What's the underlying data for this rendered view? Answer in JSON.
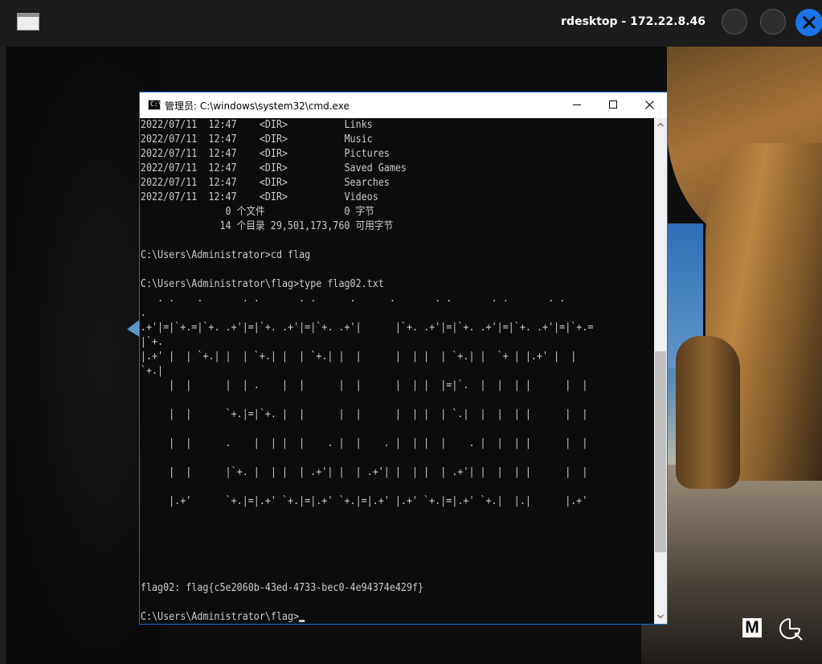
{
  "outer_window": {
    "title": "rdesktop - 172.22.8.46",
    "controls": [
      "minimize",
      "maximize",
      "close"
    ]
  },
  "cmd_window": {
    "title": "管理员: C:\\windows\\system32\\cmd.exe",
    "icon_label": "C:\\",
    "console_lines": [
      "2022/07/11  12:47    <DIR>          Links",
      "2022/07/11  12:47    <DIR>          Music",
      "2022/07/11  12:47    <DIR>          Pictures",
      "2022/07/11  12:47    <DIR>          Saved Games",
      "2022/07/11  12:47    <DIR>          Searches",
      "2022/07/11  12:47    <DIR>          Videos",
      "               0 个文件              0 字节",
      "              14 个目录 29,501,173,760 可用字节",
      "",
      "C:\\Users\\Administrator>cd flag",
      "",
      "C:\\Users\\Administrator\\flag>type flag02.txt",
      "   . .    .       . .       . .      .      .       . .       . .       . .",
      ".",
      ".+'|=|`+.=|`+. .+'|=|`+. .+'|=|`+. .+'|      |`+. .+'|=|`+. .+'|=|`+. .+'|=|`+.=",
      "|`+.",
      "|.+' |  | `+.| |  | `+.| |  | `+.| |  |      |  | |  | `+.| |  `+ | |.+' |  |",
      "`+.|",
      "     |  |      |  | .    |  |      |  |      |  | |  |=|`.  |  |  | |      |  |",
      "",
      "     |  |      `+.|=|`+. |  |      |  |      |  | |  | `.|  |  |  | |      |  |",
      "",
      "     |  |      .    |  | |  |    . |  |    . |  | |  |    . |  |  | |      |  |",
      "",
      "     |  |      |`+. |  | |  | .+'| |  | .+'| |  | |  | .+'| |  |  | |      |  |",
      "",
      "     |.+'      `+.|=|.+' `+.|=|.+' `+.|=|.+' |.+' `+.|=|.+' `+.|  |.|      |.+'",
      "",
      "",
      "",
      "",
      "",
      "flag02: flag{c5e2060b-43ed-4733-bec0-4e94374e429f}",
      "",
      "C:\\Users\\Administrator\\flag>"
    ]
  },
  "toolbar": {
    "m_label": "M"
  },
  "colors": {
    "console_bg": "#0c0c0c",
    "console_fg": "#cccccc",
    "accent": "#1a73e8",
    "window_border": "#1c6fcf"
  },
  "icons": [
    "window-icon",
    "cmd-icon",
    "minimize-icon",
    "maximize-icon",
    "close-icon",
    "scroll-up-icon",
    "scroll-down-icon",
    "m-icon",
    "pointer-icon"
  ]
}
